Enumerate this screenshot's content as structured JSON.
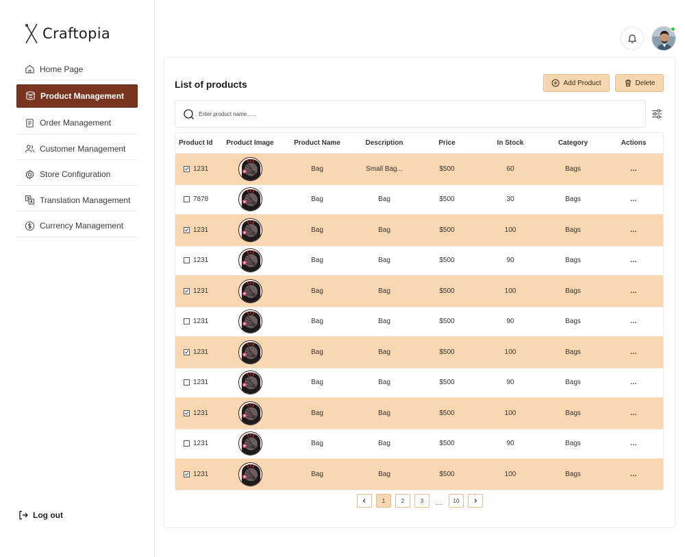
{
  "brand": {
    "name": "Craftopia"
  },
  "sidebar": {
    "items": [
      {
        "label": "Home Page",
        "icon": "home-icon",
        "active": false
      },
      {
        "label": "Product Management",
        "icon": "box-icon",
        "active": true
      },
      {
        "label": "Order Management",
        "icon": "receipt-icon",
        "active": false
      },
      {
        "label": "Customer Management",
        "icon": "users-icon",
        "active": false
      },
      {
        "label": "Store Configuration",
        "icon": "gear-icon",
        "active": false
      },
      {
        "label": "Translation Management",
        "icon": "translate-icon",
        "active": false
      },
      {
        "label": "Currency Management",
        "icon": "dollar-icon",
        "active": false
      }
    ],
    "logout_label": "Log out"
  },
  "header": {
    "bell_icon": "bell-icon",
    "avatar": "user-avatar",
    "online_status_color": "#2ecc40"
  },
  "page": {
    "title": "List of products",
    "add_label": "Add Product",
    "delete_label": "Delete",
    "search_placeholder": "Enter product name......"
  },
  "table": {
    "columns": [
      "Product Id",
      "Product Image",
      "Product Name",
      "Description",
      "Price",
      "In Stock",
      "Category",
      "Actions"
    ],
    "rows": [
      {
        "checked": true,
        "id": "1231",
        "name": "Bag",
        "description": "Small Bag...",
        "price": "$500",
        "stock": "60",
        "category": "Bags",
        "action": "..."
      },
      {
        "checked": false,
        "id": "7878",
        "name": "Bag",
        "description": "Bag",
        "price": "$500",
        "stock": "30",
        "category": "Bags",
        "action": "..."
      },
      {
        "checked": true,
        "id": "1231",
        "name": "Bag",
        "description": "Bag",
        "price": "$500",
        "stock": "100",
        "category": "Bags",
        "action": "..."
      },
      {
        "checked": false,
        "id": "1231",
        "name": "Bag",
        "description": "Bag",
        "price": "$500",
        "stock": "90",
        "category": "Bags",
        "action": "..."
      },
      {
        "checked": true,
        "id": "1231",
        "name": "Bag",
        "description": "Bag",
        "price": "$500",
        "stock": "100",
        "category": "Bags",
        "action": "..."
      },
      {
        "checked": false,
        "id": "1231",
        "name": "Bag",
        "description": "Bag",
        "price": "$500",
        "stock": "90",
        "category": "Bags",
        "action": "..."
      },
      {
        "checked": true,
        "id": "1231",
        "name": "Bag",
        "description": "Bag",
        "price": "$500",
        "stock": "100",
        "category": "Bags",
        "action": "..."
      },
      {
        "checked": false,
        "id": "1231",
        "name": "Bag",
        "description": "Bag",
        "price": "$500",
        "stock": "90",
        "category": "Bags",
        "action": "..."
      },
      {
        "checked": true,
        "id": "1231",
        "name": "Bag",
        "description": "Bag",
        "price": "$500",
        "stock": "100",
        "category": "Bags",
        "action": "..."
      },
      {
        "checked": false,
        "id": "1231",
        "name": "Bag",
        "description": "Bag",
        "price": "$500",
        "stock": "90",
        "category": "Bags",
        "action": "..."
      },
      {
        "checked": true,
        "id": "1231",
        "name": "Bag",
        "description": "Bag",
        "price": "$500",
        "stock": "100",
        "category": "Bags",
        "action": "..."
      }
    ]
  },
  "pagination": {
    "pages": [
      "1",
      "2",
      "3"
    ],
    "ellipsis": ".....",
    "last": "10",
    "current": "1"
  },
  "colors": {
    "accent": "#7a3520",
    "highlight_row": "#f8d7b1",
    "button_bg": "#f7d7b0"
  }
}
